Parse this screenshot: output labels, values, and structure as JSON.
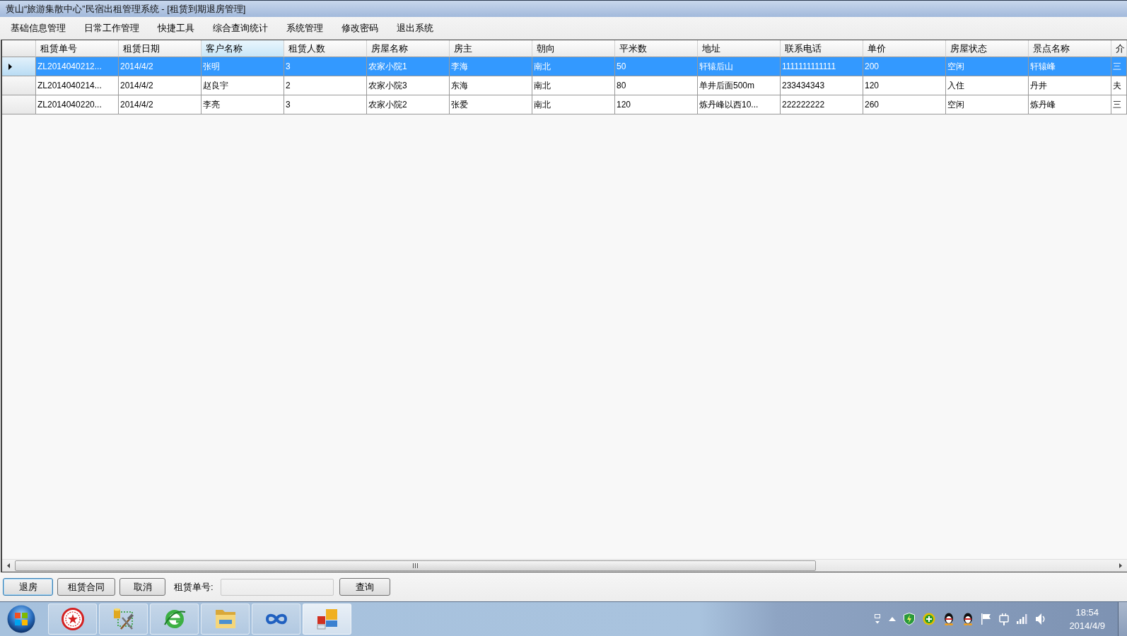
{
  "window": {
    "title": "黄山“旅游集散中心”民宿出租管理系统 - [租赁到期退房管理]"
  },
  "menu": [
    "基础信息管理",
    "日常工作管理",
    "快捷工具",
    "综合查询统计",
    "系统管理",
    "修改密码",
    "退出系统"
  ],
  "table": {
    "columns": [
      {
        "label": "租赁单号",
        "highlighted": false
      },
      {
        "label": "租赁日期",
        "highlighted": false
      },
      {
        "label": "客户名称",
        "highlighted": true
      },
      {
        "label": "租赁人数",
        "highlighted": false
      },
      {
        "label": "房屋名称",
        "highlighted": false
      },
      {
        "label": "房主",
        "highlighted": false
      },
      {
        "label": "朝向",
        "highlighted": false
      },
      {
        "label": "平米数",
        "highlighted": false
      },
      {
        "label": "地址",
        "highlighted": false
      },
      {
        "label": "联系电话",
        "highlighted": false
      },
      {
        "label": "单价",
        "highlighted": false
      },
      {
        "label": "房屋状态",
        "highlighted": false
      },
      {
        "label": "景点名称",
        "highlighted": false
      },
      {
        "label": "介",
        "highlighted": false
      }
    ],
    "rows": [
      {
        "selected": true,
        "cells": [
          "ZL2014040212...",
          "2014/4/2",
          "张明",
          "3",
          "农家小院1",
          "李海",
          "南北",
          "50",
          "轩辕后山",
          "1111111111111",
          "200",
          "空闲",
          "轩辕峰",
          "三"
        ]
      },
      {
        "selected": false,
        "cells": [
          "ZL2014040214...",
          "2014/4/2",
          "赵良宇",
          "2",
          "农家小院3",
          "东海",
          "南北",
          "80",
          "单井后面500m",
          "233434343",
          "120",
          "入住",
          "丹井",
          "夫"
        ]
      },
      {
        "selected": false,
        "cells": [
          "ZL2014040220...",
          "2014/4/2",
          "李亮",
          "3",
          "农家小院2",
          "张爱",
          "南北",
          "120",
          "炼丹峰以西10...",
          "222222222",
          "260",
          "空闲",
          "炼丹峰",
          "三"
        ]
      }
    ]
  },
  "bottom_bar": {
    "buttons": [
      {
        "label": "退房",
        "focused": true
      },
      {
        "label": "租赁合同",
        "focused": false
      },
      {
        "label": "取消",
        "focused": false
      }
    ],
    "search": {
      "label": "租赁单号:",
      "button": "查询"
    }
  },
  "taskbar": {
    "apps": [
      {
        "kind": "seal",
        "active": false
      },
      {
        "kind": "tools",
        "active": false
      },
      {
        "kind": "browser",
        "active": false
      },
      {
        "kind": "folder",
        "active": false
      },
      {
        "kind": "infinity",
        "active": false
      },
      {
        "kind": "tiles",
        "active": true
      }
    ],
    "clock": {
      "time": "18:54",
      "date": "2014/4/9"
    }
  }
}
